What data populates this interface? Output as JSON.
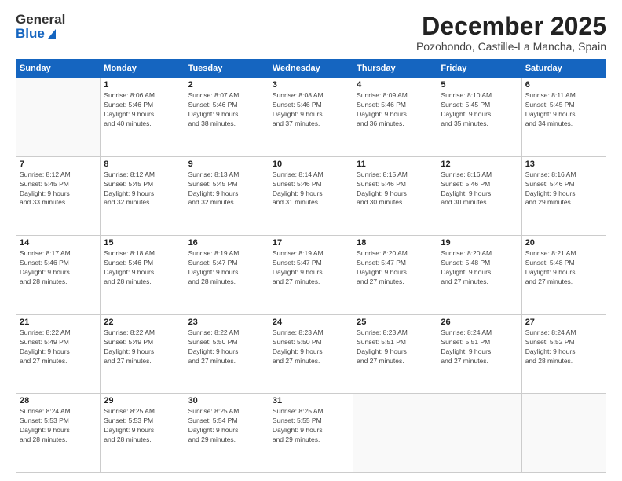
{
  "header": {
    "logo_general": "General",
    "logo_blue": "Blue",
    "title": "December 2025",
    "location": "Pozohondo, Castille-La Mancha, Spain"
  },
  "days_of_week": [
    "Sunday",
    "Monday",
    "Tuesday",
    "Wednesday",
    "Thursday",
    "Friday",
    "Saturday"
  ],
  "weeks": [
    [
      {
        "day": "",
        "info": ""
      },
      {
        "day": "1",
        "info": "Sunrise: 8:06 AM\nSunset: 5:46 PM\nDaylight: 9 hours\nand 40 minutes."
      },
      {
        "day": "2",
        "info": "Sunrise: 8:07 AM\nSunset: 5:46 PM\nDaylight: 9 hours\nand 38 minutes."
      },
      {
        "day": "3",
        "info": "Sunrise: 8:08 AM\nSunset: 5:46 PM\nDaylight: 9 hours\nand 37 minutes."
      },
      {
        "day": "4",
        "info": "Sunrise: 8:09 AM\nSunset: 5:46 PM\nDaylight: 9 hours\nand 36 minutes."
      },
      {
        "day": "5",
        "info": "Sunrise: 8:10 AM\nSunset: 5:45 PM\nDaylight: 9 hours\nand 35 minutes."
      },
      {
        "day": "6",
        "info": "Sunrise: 8:11 AM\nSunset: 5:45 PM\nDaylight: 9 hours\nand 34 minutes."
      }
    ],
    [
      {
        "day": "7",
        "info": "Sunrise: 8:12 AM\nSunset: 5:45 PM\nDaylight: 9 hours\nand 33 minutes."
      },
      {
        "day": "8",
        "info": "Sunrise: 8:12 AM\nSunset: 5:45 PM\nDaylight: 9 hours\nand 32 minutes."
      },
      {
        "day": "9",
        "info": "Sunrise: 8:13 AM\nSunset: 5:45 PM\nDaylight: 9 hours\nand 32 minutes."
      },
      {
        "day": "10",
        "info": "Sunrise: 8:14 AM\nSunset: 5:46 PM\nDaylight: 9 hours\nand 31 minutes."
      },
      {
        "day": "11",
        "info": "Sunrise: 8:15 AM\nSunset: 5:46 PM\nDaylight: 9 hours\nand 30 minutes."
      },
      {
        "day": "12",
        "info": "Sunrise: 8:16 AM\nSunset: 5:46 PM\nDaylight: 9 hours\nand 30 minutes."
      },
      {
        "day": "13",
        "info": "Sunrise: 8:16 AM\nSunset: 5:46 PM\nDaylight: 9 hours\nand 29 minutes."
      }
    ],
    [
      {
        "day": "14",
        "info": "Sunrise: 8:17 AM\nSunset: 5:46 PM\nDaylight: 9 hours\nand 28 minutes."
      },
      {
        "day": "15",
        "info": "Sunrise: 8:18 AM\nSunset: 5:46 PM\nDaylight: 9 hours\nand 28 minutes."
      },
      {
        "day": "16",
        "info": "Sunrise: 8:19 AM\nSunset: 5:47 PM\nDaylight: 9 hours\nand 28 minutes."
      },
      {
        "day": "17",
        "info": "Sunrise: 8:19 AM\nSunset: 5:47 PM\nDaylight: 9 hours\nand 27 minutes."
      },
      {
        "day": "18",
        "info": "Sunrise: 8:20 AM\nSunset: 5:47 PM\nDaylight: 9 hours\nand 27 minutes."
      },
      {
        "day": "19",
        "info": "Sunrise: 8:20 AM\nSunset: 5:48 PM\nDaylight: 9 hours\nand 27 minutes."
      },
      {
        "day": "20",
        "info": "Sunrise: 8:21 AM\nSunset: 5:48 PM\nDaylight: 9 hours\nand 27 minutes."
      }
    ],
    [
      {
        "day": "21",
        "info": "Sunrise: 8:22 AM\nSunset: 5:49 PM\nDaylight: 9 hours\nand 27 minutes."
      },
      {
        "day": "22",
        "info": "Sunrise: 8:22 AM\nSunset: 5:49 PM\nDaylight: 9 hours\nand 27 minutes."
      },
      {
        "day": "23",
        "info": "Sunrise: 8:22 AM\nSunset: 5:50 PM\nDaylight: 9 hours\nand 27 minutes."
      },
      {
        "day": "24",
        "info": "Sunrise: 8:23 AM\nSunset: 5:50 PM\nDaylight: 9 hours\nand 27 minutes."
      },
      {
        "day": "25",
        "info": "Sunrise: 8:23 AM\nSunset: 5:51 PM\nDaylight: 9 hours\nand 27 minutes."
      },
      {
        "day": "26",
        "info": "Sunrise: 8:24 AM\nSunset: 5:51 PM\nDaylight: 9 hours\nand 27 minutes."
      },
      {
        "day": "27",
        "info": "Sunrise: 8:24 AM\nSunset: 5:52 PM\nDaylight: 9 hours\nand 28 minutes."
      }
    ],
    [
      {
        "day": "28",
        "info": "Sunrise: 8:24 AM\nSunset: 5:53 PM\nDaylight: 9 hours\nand 28 minutes."
      },
      {
        "day": "29",
        "info": "Sunrise: 8:25 AM\nSunset: 5:53 PM\nDaylight: 9 hours\nand 28 minutes."
      },
      {
        "day": "30",
        "info": "Sunrise: 8:25 AM\nSunset: 5:54 PM\nDaylight: 9 hours\nand 29 minutes."
      },
      {
        "day": "31",
        "info": "Sunrise: 8:25 AM\nSunset: 5:55 PM\nDaylight: 9 hours\nand 29 minutes."
      },
      {
        "day": "",
        "info": ""
      },
      {
        "day": "",
        "info": ""
      },
      {
        "day": "",
        "info": ""
      }
    ]
  ]
}
